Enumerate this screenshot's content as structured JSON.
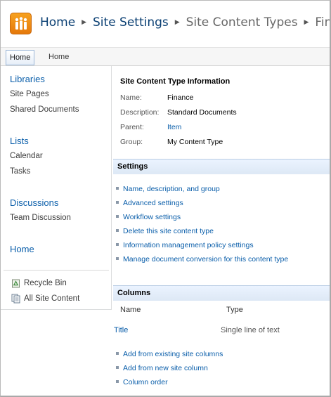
{
  "breadcrumb": {
    "items": [
      "Home",
      "Site Settings",
      "Site Content Types",
      "Finance"
    ]
  },
  "topnav": {
    "tabs": [
      "Home",
      "Home"
    ]
  },
  "leftnav": {
    "sections": [
      {
        "heading": "Libraries",
        "items": [
          "Site Pages",
          "Shared Documents"
        ]
      },
      {
        "heading": "Lists",
        "items": [
          "Calendar",
          "Tasks"
        ]
      },
      {
        "heading": "Discussions",
        "items": [
          "Team Discussion"
        ]
      },
      {
        "heading": "Home",
        "items": []
      }
    ],
    "recycle_bin": "Recycle Bin",
    "all_content": "All Site Content"
  },
  "info": {
    "title": "Site Content Type Information",
    "rows": [
      {
        "label": "Name:",
        "value": "Finance"
      },
      {
        "label": "Description:",
        "value": "Standard Documents"
      },
      {
        "label": "Parent:",
        "value": "Item"
      },
      {
        "label": "Group:",
        "value": "My Content Type"
      }
    ]
  },
  "settings": {
    "title": "Settings",
    "links": [
      "Name, description, and group",
      "Advanced settings",
      "Workflow settings",
      "Delete this site content type",
      "Information management policy settings",
      "Manage document conversion for this content type"
    ]
  },
  "columns": {
    "title": "Columns",
    "headers": [
      "Name",
      "Type"
    ],
    "rows": [
      {
        "name": "Title",
        "type": "Single line of text"
      }
    ],
    "links": [
      "Add from existing site columns",
      "Add from new site column",
      "Column order"
    ]
  },
  "colors": {
    "link": "#0a5eaa",
    "breadcrumb_link": "#0a3f73",
    "band": "#dde8f5",
    "logo": "#f39a1b"
  }
}
